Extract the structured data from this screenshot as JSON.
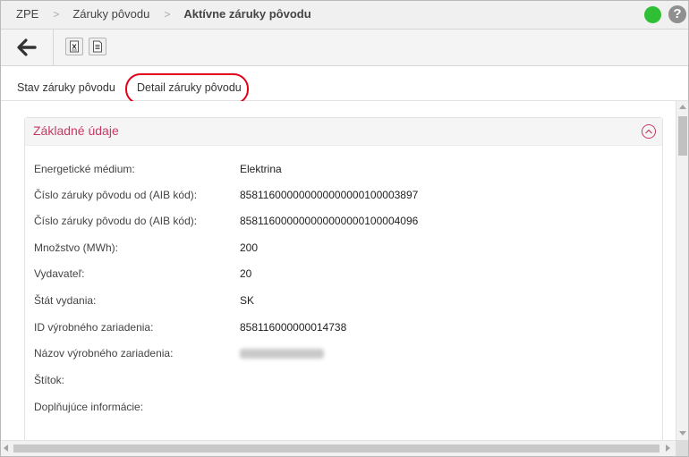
{
  "breadcrumb": {
    "items": [
      "ZPE",
      "Záruky pôvodu"
    ],
    "current": "Aktívne záruky pôvodu",
    "separator": ">"
  },
  "header": {
    "status_color": "#2fbf35",
    "status_icon": "status-online-icon",
    "help_label": "?"
  },
  "toolbar": {
    "back_icon": "arrow-left-icon",
    "buttons": [
      "export-excel-icon",
      "export-document-icon"
    ]
  },
  "tabs": [
    {
      "label": "Stav záruky pôvodu",
      "active": false
    },
    {
      "label": "Detail záruky pôvodu",
      "active": true
    }
  ],
  "section": {
    "title": "Základné údaje",
    "title_color": "#c53a63",
    "collapse_icon": "chevron-up-circle-icon",
    "rows": [
      {
        "label": "Energetické médium:",
        "value": "Elektrina"
      },
      {
        "label": "Číslo záruky pôvodu od (AIB kód):",
        "value": "858116000000000000000100003897"
      },
      {
        "label": "Číslo záruky pôvodu do (AIB kód):",
        "value": "858116000000000000000100004096"
      },
      {
        "label": "Množstvo (MWh):",
        "value": "200"
      },
      {
        "label": "Vydavateľ:",
        "value": "20"
      },
      {
        "label": "Štát vydania:",
        "value": "SK"
      },
      {
        "label": "ID výrobného zariadenia:",
        "value": "858116000000014738"
      },
      {
        "label": "Názov výrobného zariadenia:",
        "value": ""
      },
      {
        "label": "Štítok:",
        "value": ""
      },
      {
        "label": "Doplňujúce informácie:",
        "value": ""
      }
    ]
  },
  "annotation": {
    "highlight_color": "#e3001b"
  }
}
